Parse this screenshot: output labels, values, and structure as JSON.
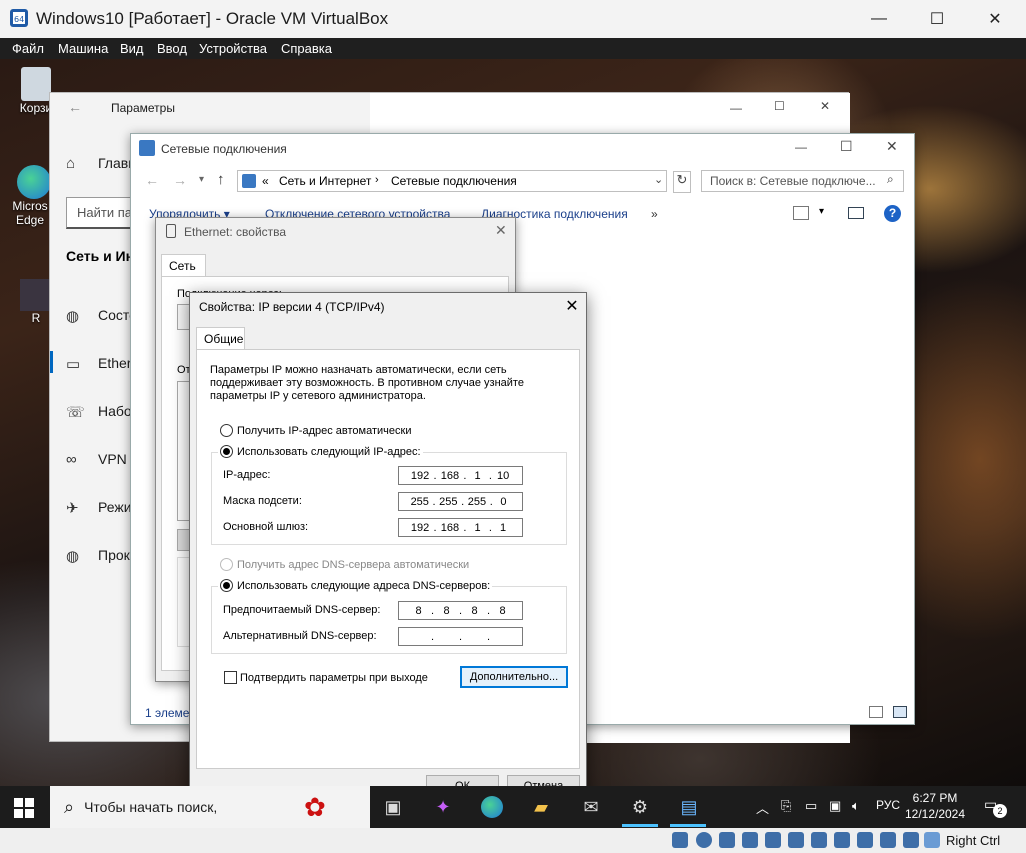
{
  "vbox": {
    "title": "Windows10 [Работает] - Oracle VM VirtualBox",
    "menu": [
      "Файл",
      "Машина",
      "Вид",
      "Ввод",
      "Устройства",
      "Справка"
    ],
    "host_key": "Right Ctrl"
  },
  "desktop": {
    "icons": [
      {
        "label": "Корзи",
        "icon": "recycle-bin-icon"
      },
      {
        "label": "Micros Edge",
        "icon": "edge-icon"
      },
      {
        "label": "R",
        "icon": "app-icon"
      }
    ]
  },
  "settings": {
    "title": "Параметры",
    "home": "Главн",
    "search_placeholder": "Найти па",
    "section": "Сеть и Инт",
    "nav": [
      {
        "label": "Состо",
        "icon": "globe-icon"
      },
      {
        "label": "Ethern",
        "icon": "ethernet-icon"
      },
      {
        "label": "Набор",
        "icon": "dialup-icon"
      },
      {
        "label": "VPN",
        "icon": "vpn-icon"
      },
      {
        "label": "Режи",
        "icon": "airplane-icon"
      },
      {
        "label": "Прокс",
        "icon": "proxy-globe-icon"
      }
    ]
  },
  "netconn": {
    "title": "Сетевые подключения",
    "breadcrumb_prefix": "«",
    "breadcrumb": [
      "Сеть и Интернет",
      "Сетевые подключения"
    ],
    "search_placeholder": "Поиск в: Сетевые подключе...",
    "commands": [
      "Упорядочить ▾",
      "Отключение сетевого устройства",
      "Диагностика подключения",
      "»"
    ],
    "status": "1 элемент"
  },
  "ethernet": {
    "title": "Ethernet: свойства",
    "tab": "Сеть",
    "connect_label": "Подключение через:",
    "components_label": "От"
  },
  "ipv4": {
    "title": "Свойства: IP версии 4 (TCP/IPv4)",
    "tab": "Общие",
    "description": "Параметры IP можно назначать автоматически, если сеть поддерживает эту возможность. В противном случае узнайте параметры IP у сетевого администратора.",
    "radio_auto_ip": "Получить IP-адрес автоматически",
    "radio_manual_ip": "Использовать следующий IP-адрес:",
    "ip_label": "IP-адрес:",
    "ip_value": [
      "192",
      "168",
      "1",
      "10"
    ],
    "mask_label": "Маска подсети:",
    "mask_value": [
      "255",
      "255",
      "255",
      "0"
    ],
    "gateway_label": "Основной шлюз:",
    "gateway_value": [
      "192",
      "168",
      "1",
      "1"
    ],
    "radio_auto_dns": "Получить адрес DNS-сервера автоматически",
    "radio_manual_dns": "Использовать следующие адреса DNS-серверов:",
    "dns1_label": "Предпочитаемый DNS-сервер:",
    "dns1_value": [
      "8",
      "8",
      "8",
      "8"
    ],
    "dns2_label": "Альтернативный DNS-сервер:",
    "dns2_value": [
      "",
      "",
      "",
      ""
    ],
    "validate_label": "Подтвердить параметры при выходе",
    "advanced_button": "Дополнительно...",
    "ok_button": "ОК",
    "cancel_button": "Отмена"
  },
  "taskbar": {
    "search_placeholder": "Чтобы начать поиск,",
    "lang": "РУС",
    "time": "6:27 PM",
    "date": "12/12/2024",
    "notifications": "2"
  }
}
